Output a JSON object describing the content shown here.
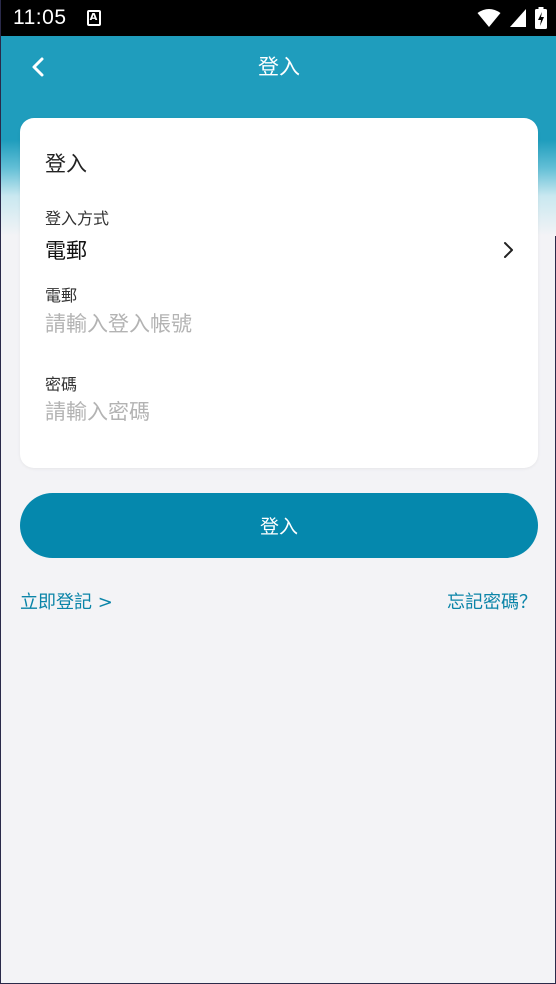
{
  "status_bar": {
    "time": "11:05",
    "notification_icon": "a-badge-icon",
    "icons": [
      "wifi-icon",
      "signal-icon",
      "battery-charging-icon"
    ]
  },
  "nav": {
    "back_icon": "chevron-left-icon",
    "title": "登入"
  },
  "card": {
    "title": "登入",
    "method": {
      "label": "登入方式",
      "value": "電郵",
      "icon": "chevron-right-icon"
    },
    "email": {
      "label": "電郵",
      "value": "",
      "placeholder": "請輸入登入帳號"
    },
    "password": {
      "label": "密碼",
      "value": "",
      "placeholder": "請輸入密碼"
    }
  },
  "login_button": {
    "label": "登入"
  },
  "links": {
    "register": "立即登記 >",
    "forgot_password": "忘記密碼？"
  },
  "colors": {
    "header": "#1f9dbd",
    "button": "#0588ad",
    "link": "#0a84a8",
    "background": "#f3f3f6"
  }
}
